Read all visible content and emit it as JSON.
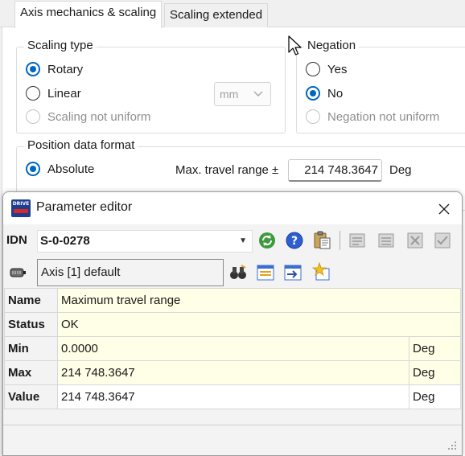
{
  "tabs": [
    {
      "label": "Axis mechanics & scaling",
      "active": true
    },
    {
      "label": "Scaling extended",
      "active": false
    }
  ],
  "scaling_type": {
    "title": "Scaling type",
    "options": [
      {
        "label": "Rotary",
        "checked": true,
        "disabled": false
      },
      {
        "label": "Linear",
        "checked": false,
        "disabled": false
      },
      {
        "label": "Scaling not uniform",
        "checked": false,
        "disabled": true
      }
    ],
    "unit_select": {
      "value": "mm",
      "disabled": true
    }
  },
  "negation": {
    "title": "Negation",
    "options": [
      {
        "label": "Yes",
        "checked": false,
        "disabled": false
      },
      {
        "label": "No",
        "checked": true,
        "disabled": false
      },
      {
        "label": "Negation not uniform",
        "checked": false,
        "disabled": true
      }
    ]
  },
  "position_format": {
    "title": "Position data format",
    "options": [
      {
        "label": "Absolute",
        "checked": true
      }
    ],
    "max_travel_label": "Max. travel range ±",
    "max_travel_value": "214 748.3647",
    "max_travel_unit": "Deg"
  },
  "param_editor": {
    "title": "Parameter editor",
    "app_icon_text": "DRIVE",
    "idn_label": "IDN",
    "idn_value": "S-0-0278",
    "axis_value": "Axis [1] default",
    "rows": [
      {
        "label": "Name",
        "value": "Maximum travel range",
        "unit": null
      },
      {
        "label": "Status",
        "value": "OK",
        "unit": null
      },
      {
        "label": "Min",
        "value": "0.0000",
        "unit": "Deg"
      },
      {
        "label": "Max",
        "value": "214 748.3647",
        "unit": "Deg"
      },
      {
        "label": "Value",
        "value": "214 748.3647",
        "unit": "Deg"
      }
    ]
  }
}
